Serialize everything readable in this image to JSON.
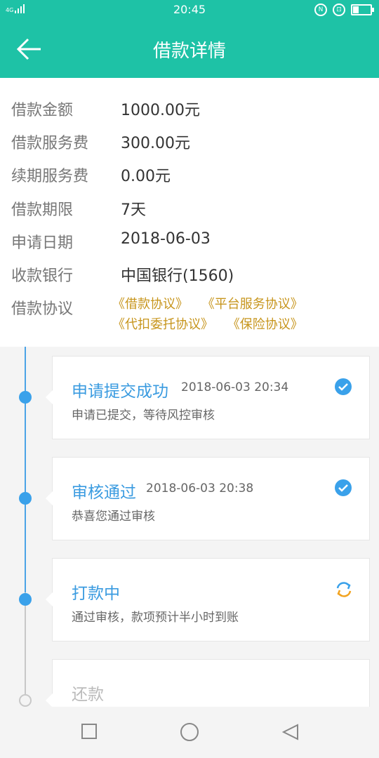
{
  "status_bar": {
    "network": "4G",
    "time": "20:45",
    "icons": [
      "nfc-icon",
      "lock-rotation-icon",
      "battery-icon"
    ],
    "battery_level": 0.3
  },
  "header": {
    "title": "借款详情",
    "back_icon": "back-arrow-icon"
  },
  "details": [
    {
      "label": "借款金额",
      "value": "1000.00元"
    },
    {
      "label": "借款服务费",
      "value": "300.00元"
    },
    {
      "label": "续期服务费",
      "value": "0.00元"
    },
    {
      "label": "借款期限",
      "value": "7天"
    },
    {
      "label": "申请日期",
      "value": "2018-06-03"
    },
    {
      "label": "收款银行",
      "value": "中国银行(1560)"
    },
    {
      "label": "借款协议",
      "value": ""
    }
  ],
  "agreements": [
    "《借款协议》",
    "《平台服务协议》",
    "《代扣委托协议》",
    "《保险协议》"
  ],
  "timeline": [
    {
      "title": "申请提交成功",
      "time": "2018-06-03 20:34",
      "desc": "申请已提交，等待风控审核",
      "status": "done"
    },
    {
      "title": "审核通过",
      "time": "2018-06-03 20:38",
      "desc": "恭喜您通过审核",
      "status": "done"
    },
    {
      "title": "打款中",
      "time": "",
      "desc": "通过审核，款项预计半小时到账",
      "status": "processing"
    },
    {
      "title": "还款",
      "time": "",
      "desc": "",
      "status": "pending"
    }
  ],
  "colors": {
    "primary": "#1ec2a6",
    "accent_blue": "#3aa1ea",
    "agreement_gold": "#c7951c",
    "processing_orange": "#f2a320"
  },
  "bottom_nav": [
    "square-icon",
    "circle-icon",
    "triangle-back-icon"
  ]
}
